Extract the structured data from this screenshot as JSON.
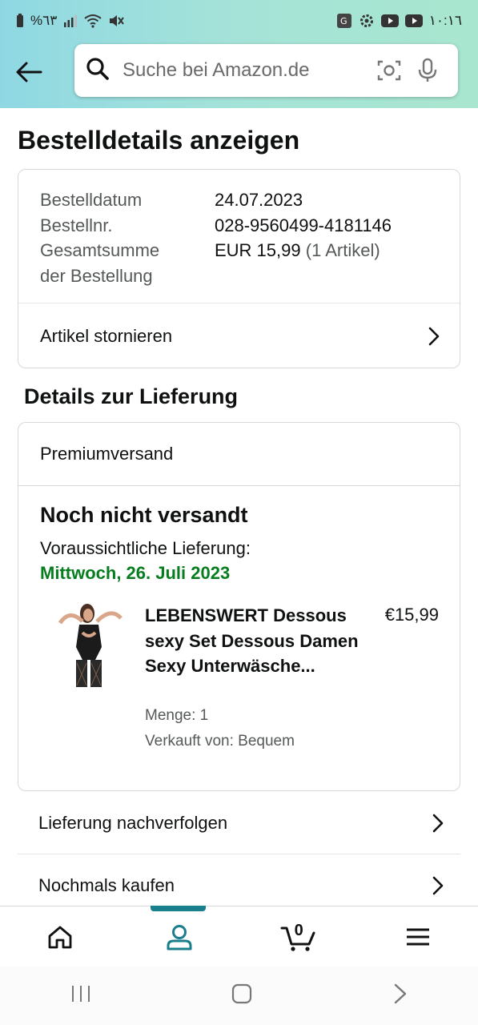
{
  "status_bar": {
    "battery_text": "%٦٣",
    "time": "١٠:١٦"
  },
  "header": {
    "search_placeholder": "Suche bei Amazon.de"
  },
  "page_title": "Bestelldetails anzeigen",
  "order_summary": {
    "rows": [
      {
        "label": "Bestelldatum",
        "value": "24.07.2023",
        "extra": ""
      },
      {
        "label": "Bestellnr.",
        "value": "028-9560499-4181146",
        "extra": ""
      },
      {
        "label": "Gesamtsumme",
        "value": "EUR 15,99",
        "extra": "(1 Artikel)"
      },
      {
        "label": "der Bestellung",
        "value": "",
        "extra": ""
      }
    ],
    "cancel_label": "Artikel stornieren"
  },
  "delivery": {
    "section_title": "Details zur Lieferung",
    "shipping_method": "Premiumversand",
    "status_title": "Noch nicht versandt",
    "estimated_label": "Voraussichtliche Lieferung:",
    "estimated_date": "Mittwoch, 26. Juli 2023",
    "item": {
      "title": "LEBENSWERT Dessous sexy Set Dessous Damen Sexy Unterwäsche...",
      "price": "€15,99",
      "quantity": "Menge: 1",
      "seller": "Verkauft von: Bequem"
    }
  },
  "actions": {
    "track": "Lieferung nachverfolgen",
    "buy_again": "Nochmals kaufen"
  },
  "tabbar": {
    "cart_count": "0",
    "active_tab": "account",
    "accent_color": "#1a7f8c"
  }
}
